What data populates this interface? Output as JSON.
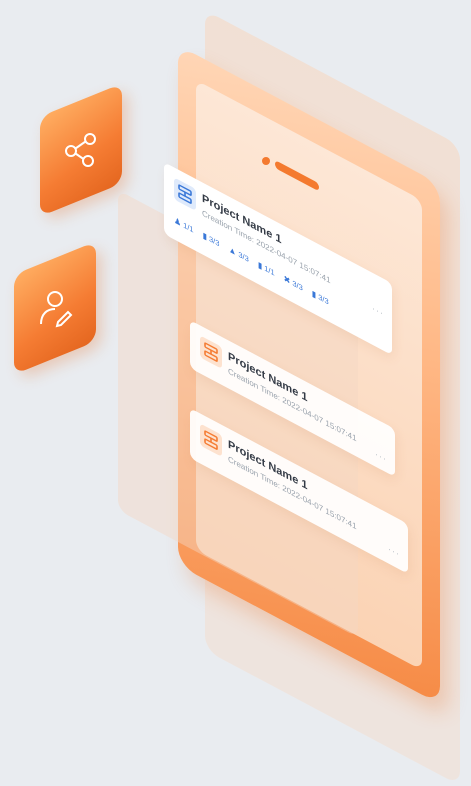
{
  "colors": {
    "accent": "#f57c33",
    "background": "#e9ecf0",
    "stat_blue": "#3a78d8"
  },
  "tiles": [
    {
      "icon": "share-icon"
    },
    {
      "icon": "user-edit-icon"
    }
  ],
  "cards": [
    {
      "icon": "project-icon",
      "title": "Project Name 1",
      "time": "Creation Time: 2022-04-07 15:07:41",
      "more": "···",
      "stats": [
        {
          "icon": "people-icon",
          "value": "1/1"
        },
        {
          "icon": "document-icon",
          "value": "3/3"
        },
        {
          "icon": "folder-icon",
          "value": "3/3"
        },
        {
          "icon": "book-icon",
          "value": "1/1"
        },
        {
          "icon": "tool-icon",
          "value": "3/3"
        },
        {
          "icon": "file-icon",
          "value": "3/3"
        }
      ]
    },
    {
      "icon": "project-icon",
      "title": "Project Name 1",
      "time": "Creation Time: 2022-04-07 15:07:41",
      "more": "···"
    },
    {
      "icon": "project-icon",
      "title": "Project Name 1",
      "time": "Creation Time: 2022-04-07 15:07:41",
      "more": "···"
    }
  ]
}
